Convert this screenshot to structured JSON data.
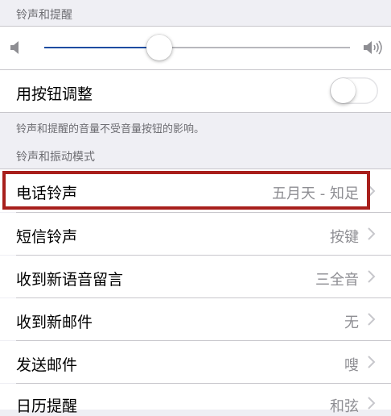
{
  "sections": {
    "ringtones_alerts_header": "铃声和提醒",
    "ring_vibrate_patterns_header": "铃声和振动模式"
  },
  "volume": {
    "level": 0.3,
    "low_icon": "speaker-low-icon",
    "high_icon": "speaker-high-icon",
    "fill_color": "#1e4da1",
    "track_color": "#b8b8bd"
  },
  "change_with_buttons": {
    "label": "用按钮调整",
    "enabled": false
  },
  "volume_note": "铃声和提醒的音量不受音量按钮的影响。",
  "sound_rows": [
    {
      "label": "电话铃声",
      "value": "五月天 - 知足"
    },
    {
      "label": "短信铃声",
      "value": "按键"
    },
    {
      "label": "收到新语音留言",
      "value": "三全音"
    },
    {
      "label": "收到新邮件",
      "value": "无"
    },
    {
      "label": "发送邮件",
      "value": "嗖"
    },
    {
      "label": "日历提醒",
      "value": "和弦"
    }
  ],
  "highlight_color": "#a81f1c"
}
